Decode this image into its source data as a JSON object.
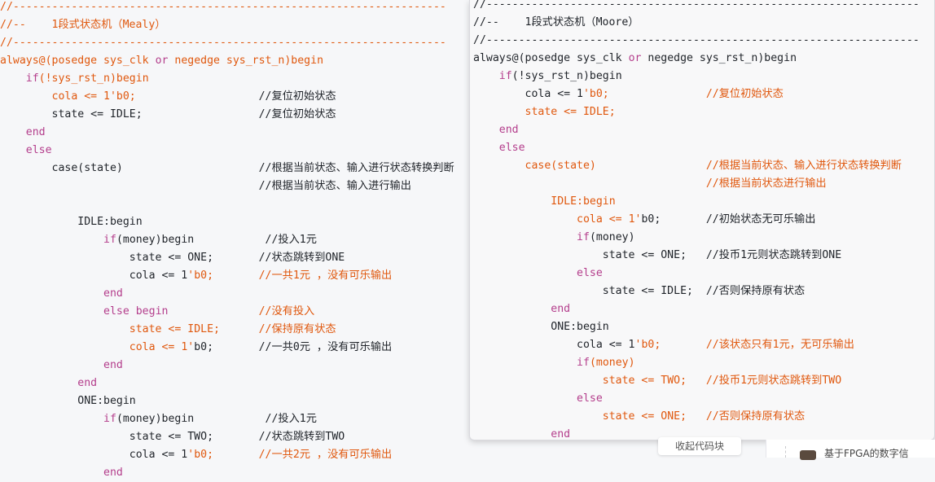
{
  "left_code": {
    "lines": [
      [
        {
          "c": "orange",
          "t": "//-------------------------------------------------------------------"
        }
      ],
      [
        {
          "c": "orange",
          "t": "//--    1段式状态机（Mealy）"
        }
      ],
      [
        {
          "c": "orange",
          "t": "//-------------------------------------------------------------------"
        }
      ],
      [
        {
          "c": "orange",
          "t": "always@(posedge sys_clk "
        },
        {
          "c": "kw",
          "t": "or"
        },
        {
          "c": "orange",
          "t": " negedge sys_rst_n)begin"
        }
      ],
      [
        {
          "c": "plain",
          "t": "    "
        },
        {
          "c": "kw",
          "t": "if"
        },
        {
          "c": "orange",
          "t": "(!sys_rst_n)begin"
        }
      ],
      [
        {
          "c": "plain",
          "t": "        "
        },
        {
          "c": "orange",
          "t": "cola <= 1'b0;"
        },
        {
          "c": "plain",
          "t": "                   //复位初始状态"
        }
      ],
      [
        {
          "c": "plain",
          "t": "        state <= IDLE;                  //复位初始状态"
        }
      ],
      [
        {
          "c": "plain",
          "t": "    "
        },
        {
          "c": "kw",
          "t": "end"
        }
      ],
      [
        {
          "c": "plain",
          "t": "    "
        },
        {
          "c": "kw",
          "t": "else"
        }
      ],
      [
        {
          "c": "plain",
          "t": "        case(state)                     //根据当前状态、输入进行状态转换判断"
        }
      ],
      [
        {
          "c": "plain",
          "t": "                                        //根据当前状态、输入进行输出"
        }
      ],
      [
        {
          "c": "plain",
          "t": ""
        }
      ],
      [
        {
          "c": "plain",
          "t": "            IDLE:begin"
        }
      ],
      [
        {
          "c": "plain",
          "t": "                "
        },
        {
          "c": "kw",
          "t": "if"
        },
        {
          "c": "plain",
          "t": "(money)begin           //投入1元"
        }
      ],
      [
        {
          "c": "plain",
          "t": "                    state <= ONE;       //状态跳转到ONE"
        }
      ],
      [
        {
          "c": "plain",
          "t": "                    cola <= 1"
        },
        {
          "c": "orange",
          "t": "'b0;       //一共1元 ，没有可乐输出"
        }
      ],
      [
        {
          "c": "plain",
          "t": "                "
        },
        {
          "c": "kw",
          "t": "end"
        }
      ],
      [
        {
          "c": "plain",
          "t": "                "
        },
        {
          "c": "kw",
          "t": "else begin"
        },
        {
          "c": "plain",
          "t": "              "
        },
        {
          "c": "orange",
          "t": "//没有投入"
        }
      ],
      [
        {
          "c": "plain",
          "t": "                    "
        },
        {
          "c": "orange",
          "t": "state <= IDLE;      //保持原有状态"
        }
      ],
      [
        {
          "c": "plain",
          "t": "                    "
        },
        {
          "c": "orange",
          "t": "cola <= 1'"
        },
        {
          "c": "plain",
          "t": "b0;       //一共0元 ，没有可乐输出"
        }
      ],
      [
        {
          "c": "plain",
          "t": "                "
        },
        {
          "c": "kw",
          "t": "end"
        }
      ],
      [
        {
          "c": "plain",
          "t": "            "
        },
        {
          "c": "kw",
          "t": "end"
        }
      ],
      [
        {
          "c": "plain",
          "t": "            ONE:begin"
        }
      ],
      [
        {
          "c": "plain",
          "t": "                "
        },
        {
          "c": "kw",
          "t": "if"
        },
        {
          "c": "plain",
          "t": "(money)begin           //投入1元"
        }
      ],
      [
        {
          "c": "plain",
          "t": "                    state <= TWO;       //状态跳转到TWO"
        }
      ],
      [
        {
          "c": "plain",
          "t": "                    cola <= 1"
        },
        {
          "c": "orange",
          "t": "'b0;       //一共2元 ，没有可乐输出"
        }
      ],
      [
        {
          "c": "plain",
          "t": "                "
        },
        {
          "c": "kw",
          "t": "end"
        }
      ]
    ]
  },
  "right_code": {
    "lines": [
      [
        {
          "c": "plain",
          "t": "//-------------------------------------------------------------------"
        }
      ],
      [
        {
          "c": "plain",
          "t": "//--    1段式状态机（Moore）"
        }
      ],
      [
        {
          "c": "plain",
          "t": "//-------------------------------------------------------------------"
        }
      ],
      [
        {
          "c": "plain",
          "t": "always@(posedge sys_clk "
        },
        {
          "c": "kw",
          "t": "or"
        },
        {
          "c": "plain",
          "t": " negedge sys_rst_n)begin"
        }
      ],
      [
        {
          "c": "plain",
          "t": "    "
        },
        {
          "c": "kw",
          "t": "if"
        },
        {
          "c": "plain",
          "t": "(!sys_rst_n)begin"
        }
      ],
      [
        {
          "c": "plain",
          "t": "        cola <= 1"
        },
        {
          "c": "orange",
          "t": "'b0;               //复位初始状态"
        }
      ],
      [
        {
          "c": "plain",
          "t": "        "
        },
        {
          "c": "orange",
          "t": "state <= IDLE;"
        }
      ],
      [
        {
          "c": "plain",
          "t": "    "
        },
        {
          "c": "kw",
          "t": "end"
        }
      ],
      [
        {
          "c": "plain",
          "t": "    "
        },
        {
          "c": "kw",
          "t": "else"
        }
      ],
      [
        {
          "c": "plain",
          "t": "        "
        },
        {
          "c": "orange",
          "t": "case(state)                 //根据当前状态、输入进行状态转换判断"
        }
      ],
      [
        {
          "c": "plain",
          "t": "                                    "
        },
        {
          "c": "orange",
          "t": "//根据当前状态进行输出"
        }
      ],
      [
        {
          "c": "plain",
          "t": "            "
        },
        {
          "c": "orange",
          "t": "IDLE:begin"
        }
      ],
      [
        {
          "c": "plain",
          "t": "                "
        },
        {
          "c": "orange",
          "t": "cola <= 1'"
        },
        {
          "c": "plain",
          "t": "b0;       //初始状态无可乐输出"
        }
      ],
      [
        {
          "c": "plain",
          "t": "                "
        },
        {
          "c": "kw",
          "t": "if"
        },
        {
          "c": "plain",
          "t": "(money)"
        }
      ],
      [
        {
          "c": "plain",
          "t": "                    state <= ONE;   //投币1元则状态跳转到ONE"
        }
      ],
      [
        {
          "c": "plain",
          "t": "                "
        },
        {
          "c": "kw",
          "t": "else"
        }
      ],
      [
        {
          "c": "plain",
          "t": "                    state <= IDLE;  //否则保持原有状态"
        }
      ],
      [
        {
          "c": "plain",
          "t": "            "
        },
        {
          "c": "kw",
          "t": "end"
        }
      ],
      [
        {
          "c": "plain",
          "t": "            ONE:begin"
        }
      ],
      [
        {
          "c": "plain",
          "t": "                cola <= 1"
        },
        {
          "c": "orange",
          "t": "'b0;       //该状态只有1元，无可乐输出"
        }
      ],
      [
        {
          "c": "plain",
          "t": "                "
        },
        {
          "c": "kw",
          "t": "if"
        },
        {
          "c": "orange",
          "t": "(money)"
        }
      ],
      [
        {
          "c": "plain",
          "t": "                    "
        },
        {
          "c": "orange",
          "t": "state <= TWO;   //投币1元则状态跳转到TWO"
        }
      ],
      [
        {
          "c": "plain",
          "t": "                "
        },
        {
          "c": "kw",
          "t": "else"
        }
      ],
      [
        {
          "c": "plain",
          "t": "                    "
        },
        {
          "c": "orange",
          "t": "state <= ONE;   //否则保持原有状态"
        }
      ],
      [
        {
          "c": "plain",
          "t": "            "
        },
        {
          "c": "kw",
          "t": "end"
        }
      ]
    ]
  },
  "tooltip": {
    "text": "收起代码块"
  },
  "sidebar": {
    "text": "基于FPGA的数字信"
  },
  "colors": {
    "orange": "#e0580e",
    "keyword": "#b43e8c",
    "plain": "#1f2329"
  }
}
